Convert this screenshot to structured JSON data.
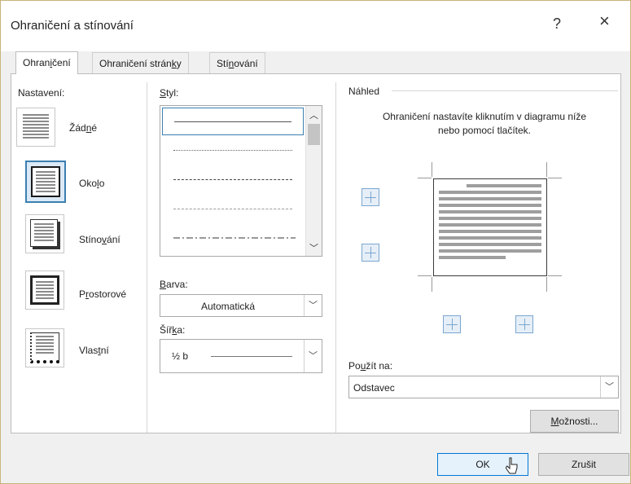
{
  "window": {
    "title": "Ohraničení a stínování",
    "help": "?",
    "close": "×"
  },
  "tabs": [
    {
      "label": "Ohraničení",
      "underline_pre": "Ohran",
      "underline_char": "i",
      "underline_post": "čení",
      "active": true
    },
    {
      "label": "Ohraničení stránky",
      "underline_pre": "Ohraničení strán",
      "underline_char": "k",
      "underline_post": "y",
      "active": false
    },
    {
      "label": "Stínování",
      "underline_pre": "Stí",
      "underline_char": "n",
      "underline_post": "ování",
      "active": false
    }
  ],
  "settings": {
    "label": "Nastavení:",
    "items": [
      {
        "pre": "Žád",
        "u": "n",
        "post": "é",
        "selected": false
      },
      {
        "pre": "Oko",
        "u": "l",
        "post": "o",
        "selected": true
      },
      {
        "pre": "Stíno",
        "u": "v",
        "post": "ání",
        "selected": false
      },
      {
        "pre": "P",
        "u": "r",
        "post": "ostorové",
        "selected": false
      },
      {
        "pre": "Vlas",
        "u": "t",
        "post": "ní",
        "selected": false
      }
    ]
  },
  "style": {
    "label_u": "S",
    "label_rest": "tyl:",
    "items": [
      "solid",
      "dotted-fine",
      "dotted",
      "dashed-fine",
      "dash-dot"
    ]
  },
  "color": {
    "label_u": "B",
    "label_rest": "arva:",
    "value": "Automatická"
  },
  "width": {
    "label_pre": "Šíř",
    "label_u": "k",
    "label_post": "a:",
    "value": "½ b"
  },
  "preview": {
    "label": "Náhled",
    "hint": "Ohraničení nastavíte kliknutím v diagramu níže nebo pomocí tlačítek."
  },
  "apply_to": {
    "label_pre": "Po",
    "label_u": "u",
    "label_post": "žít na:",
    "value": "Odstavec"
  },
  "buttons": {
    "options_u": "M",
    "options_rest": "ožnosti...",
    "ok": "OK",
    "cancel": "Zrušit"
  }
}
